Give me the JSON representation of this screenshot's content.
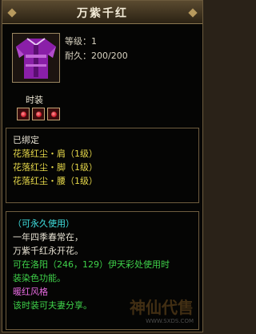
{
  "item": {
    "title": "万紫千红",
    "level_label": "等级：1",
    "durability_label": "耐久：200/200",
    "category": "时装",
    "slots": [
      "gem",
      "gem",
      "gem"
    ]
  },
  "bound": {
    "status": "已绑定",
    "set_pieces": [
      "花落红尘・肩（1级）",
      "花落红尘・脚（1级）",
      "花落红尘・腰（1级）"
    ]
  },
  "description": {
    "usage": "（可永久使用）",
    "poem_1": "一年四季春常在，",
    "poem_2": "万紫千红永开花。",
    "dye_info_1": "可在洛阳（246，129）伊天彩处使用时",
    "dye_info_2": "装染色功能。",
    "style": "暖红风格",
    "note": "该时装可夫妻分享。"
  },
  "watermark": {
    "brand": "神仙代售",
    "url": "WWW.SXDS.COM"
  }
}
